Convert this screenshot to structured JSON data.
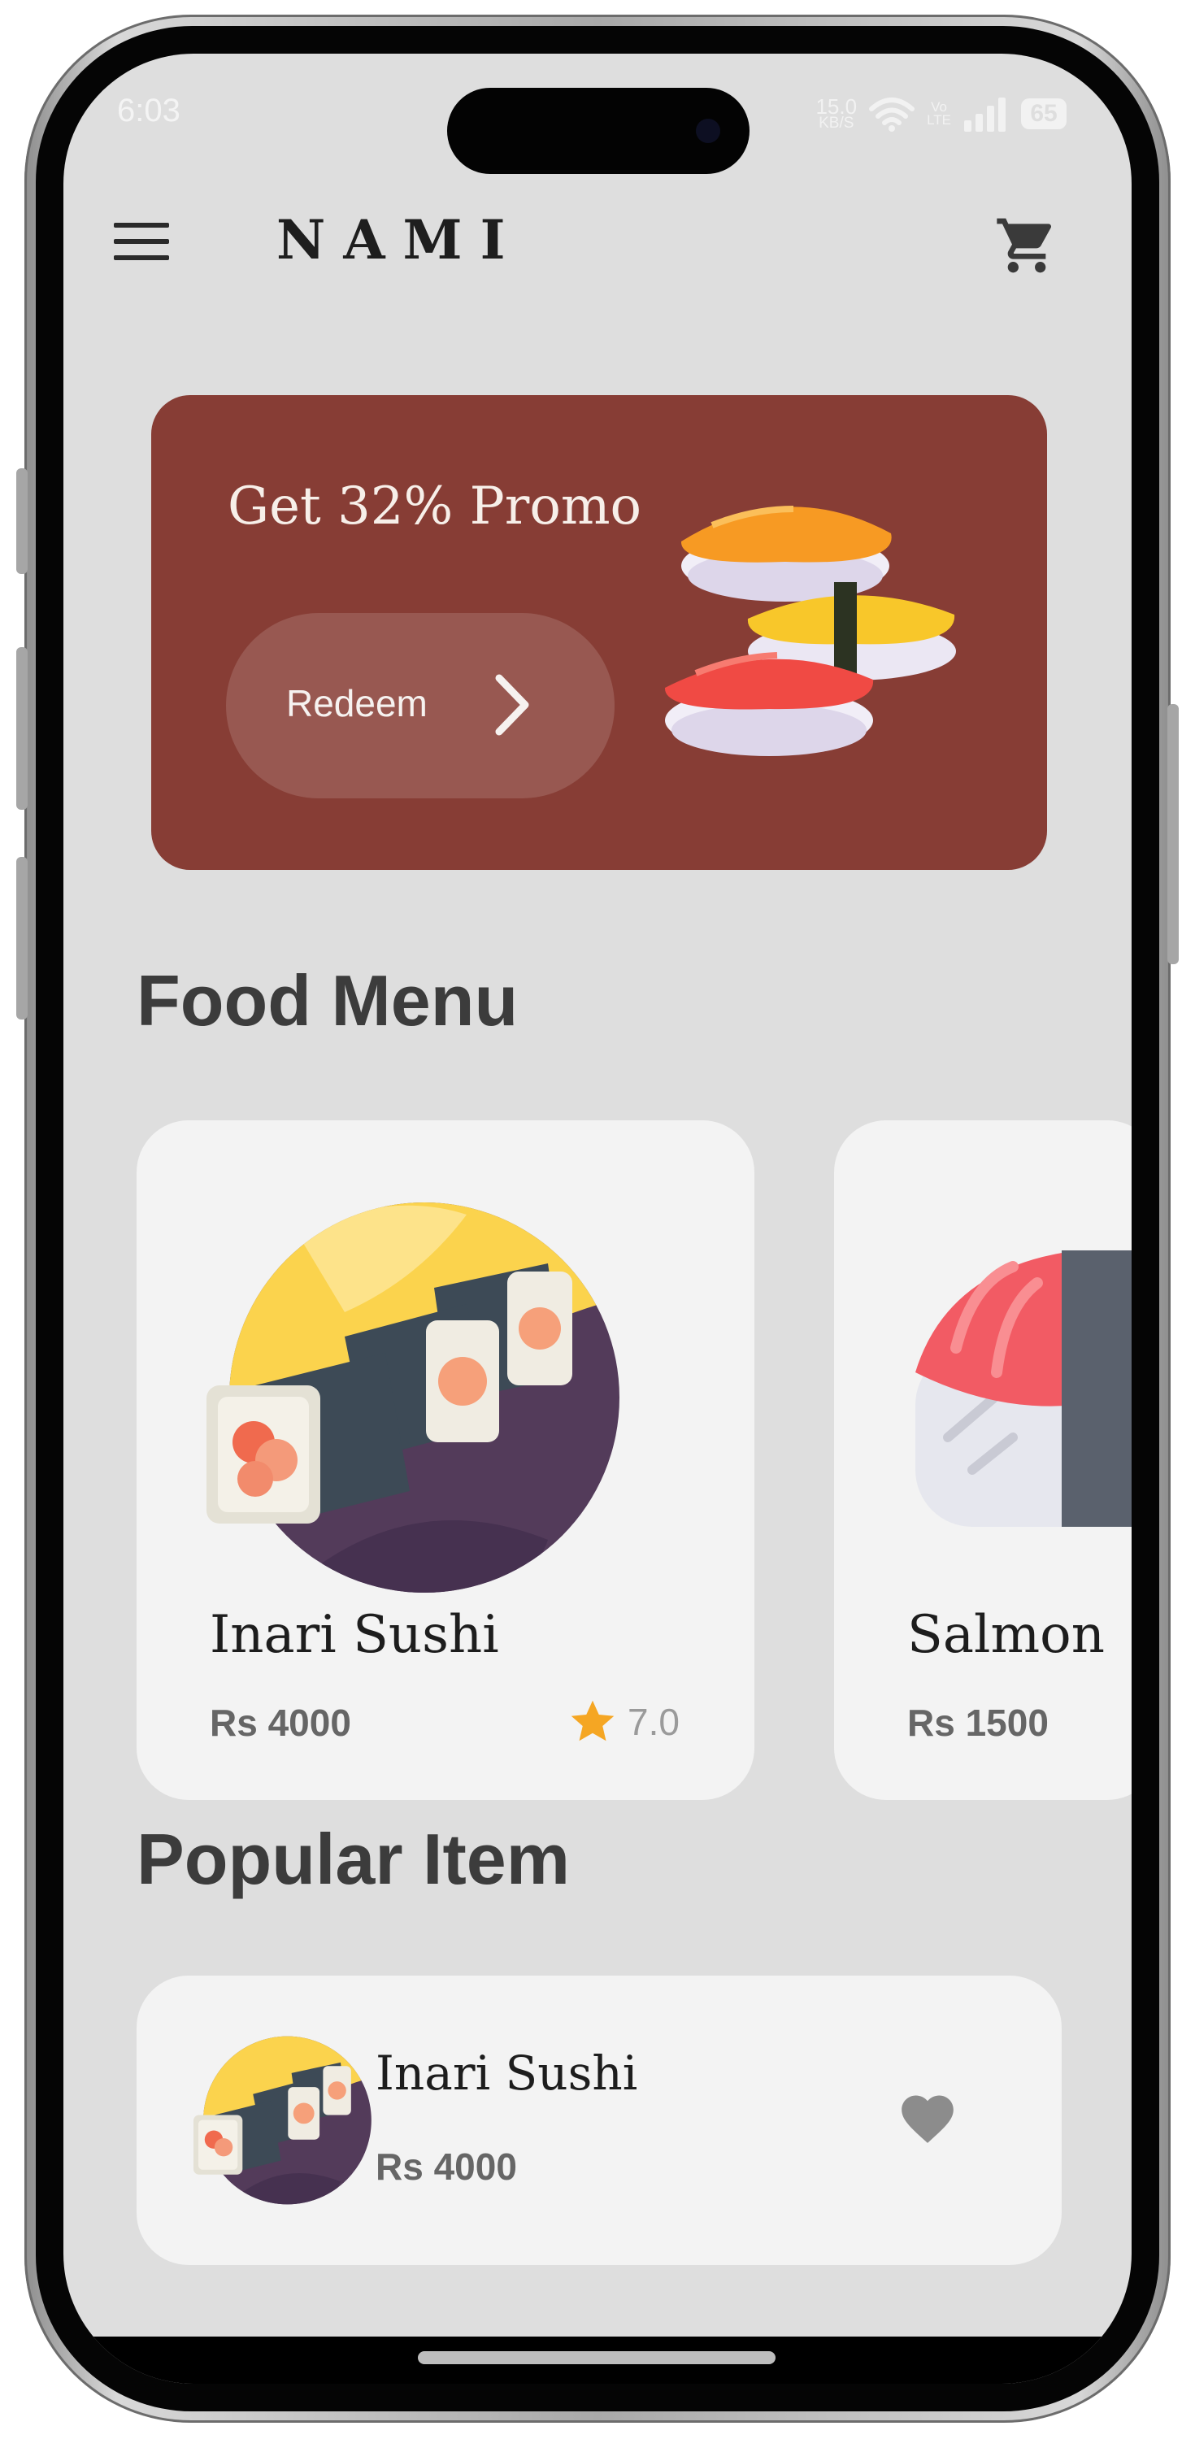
{
  "status_bar": {
    "time": "6:03",
    "net_speed_value": "15.0",
    "net_speed_unit": "KB/S",
    "volte_top": "Vo",
    "volte_bottom": "LTE",
    "battery": "65"
  },
  "header": {
    "logo": "NAMI",
    "menu_icon": "hamburger-menu-icon",
    "cart_icon": "shopping-cart-icon"
  },
  "promo": {
    "title": "Get 32% Promo",
    "button_label": "Redeem",
    "background": "#873d35"
  },
  "food_menu": {
    "title": "Food Menu",
    "items": [
      {
        "name": "Inari Sushi",
        "price": "Rs 4000",
        "rating": "7.0"
      },
      {
        "name": "Salmon",
        "price": "Rs 1500"
      }
    ]
  },
  "popular": {
    "title": "Popular Item",
    "items": [
      {
        "name": "Inari Sushi",
        "price": "Rs 4000"
      }
    ]
  },
  "colors": {
    "screen_bg": "#dedede",
    "card_bg": "#f3f3f3",
    "star": "#f5a623",
    "heading": "#3c3c3c"
  }
}
